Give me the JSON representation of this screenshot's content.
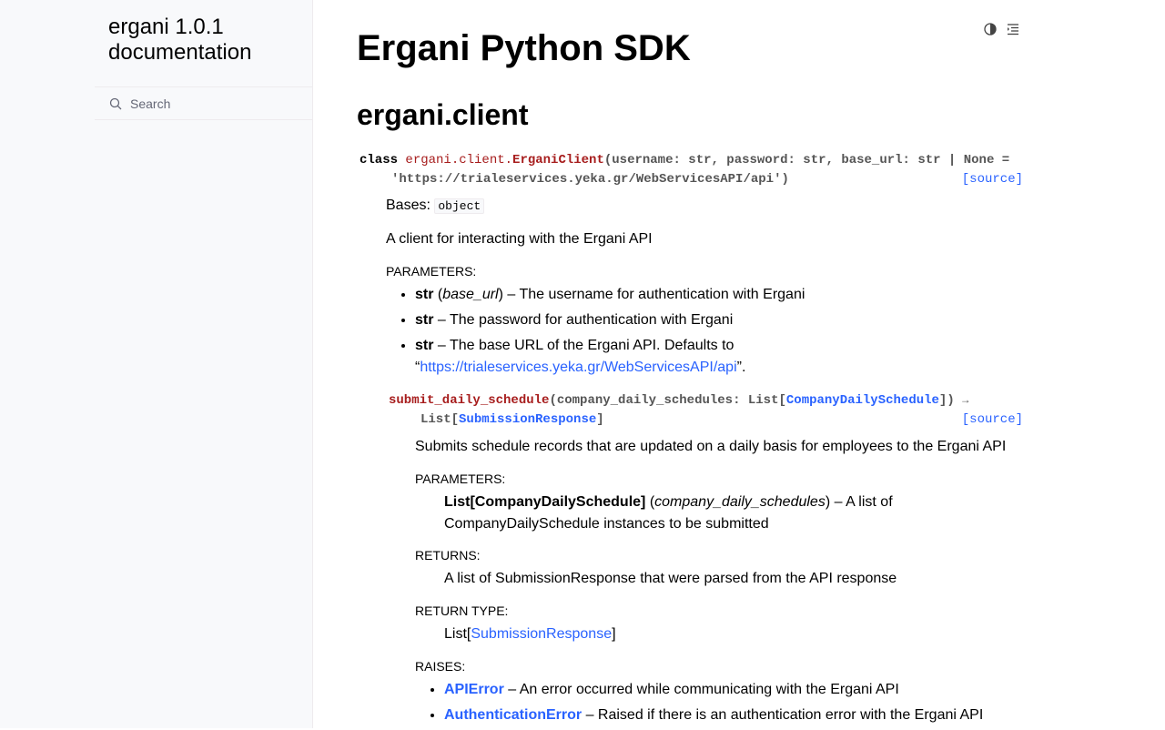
{
  "sidebar": {
    "brand": "ergani 1.0.1 documentation",
    "search_placeholder": "Search"
  },
  "header": {
    "theme_icon": "contrast-icon",
    "toc_icon": "toc-icon"
  },
  "page": {
    "title": "Ergani Python SDK",
    "module": "ergani.client"
  },
  "class": {
    "keyword": "class",
    "module_prefix": "ergani.client.",
    "name": "ErganiClient",
    "params": "(username: str, password: str, base_url: str | None =",
    "default": "'https://trialeservices.yeka.gr/WebServicesAPI/api')",
    "source": "[source]",
    "bases_label": "Bases:",
    "bases": "object",
    "description": "A client for interacting with the Ergani API",
    "parameters_label": "Parameters:",
    "params_list": [
      {
        "type": "str",
        "name": "base_url",
        "desc": "– The username for authentication with Ergani"
      },
      {
        "type": "str",
        "desc": "– The password for authentication with Ergani"
      },
      {
        "type": "str",
        "desc": "– The base URL of the Ergani API. Defaults to",
        "link": "https://trialeservices.yeka.gr/WebServicesAPI/api"
      }
    ]
  },
  "method": {
    "name": "submit_daily_schedule",
    "params_prefix": "(company_daily_schedules: List[",
    "param_type": "CompanyDailySchedule",
    "params_suffix": "])",
    "arrow": "→",
    "ret_prefix": "List[",
    "ret_type": "SubmissionResponse",
    "ret_suffix": "]",
    "source": "[source]",
    "description": "Submits schedule records that are updated on a daily basis for employees to the Ergani API",
    "parameters_label": "Parameters:",
    "param_type_text": "List[CompanyDailySchedule]",
    "param_name": "company_daily_schedules",
    "param_desc": "– A list of CompanyDailySchedule instances to be submitted",
    "returns_label": "Returns:",
    "returns": "A list of SubmissionResponse that were parsed from the API response",
    "return_type_label": "Return type:",
    "rt_prefix": "List[",
    "rt_link": "SubmissionResponse",
    "rt_suffix": "]",
    "raises_label": "Raises:",
    "raises": [
      {
        "name": "APIError",
        "desc": "– An error occurred while communicating with the Ergani API"
      },
      {
        "name": "AuthenticationError",
        "desc": "– Raised if there is an authentication error with the Ergani API"
      }
    ]
  }
}
